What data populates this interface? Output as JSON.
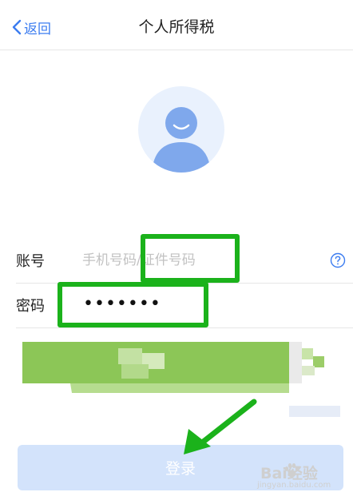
{
  "nav": {
    "back_label": "返回",
    "title": "个人所得税"
  },
  "form": {
    "account": {
      "label": "账号",
      "placeholder": "手机号码/证件号码",
      "value": ""
    },
    "password": {
      "label": "密码",
      "masked_value": "•••••••"
    }
  },
  "login_button": {
    "label": "登录"
  },
  "watermark": {
    "brand": "Bai经验",
    "url": "jingyan.baidu.com"
  },
  "icons": {
    "back": "chevron-left-icon",
    "avatar": "user-avatar-icon",
    "help": "question-circle-icon",
    "arrow": "annotation-arrow-icon",
    "paw": "baidu-paw-icon"
  },
  "colors": {
    "accent": "#3b7cf0",
    "highlight_box": "#1bb21b",
    "login_button_bg": "#d3e3fb",
    "avatar_bg": "#e9f1fd",
    "avatar_figure": "#7fa8ec",
    "mosaic_green": "#8cc657"
  }
}
